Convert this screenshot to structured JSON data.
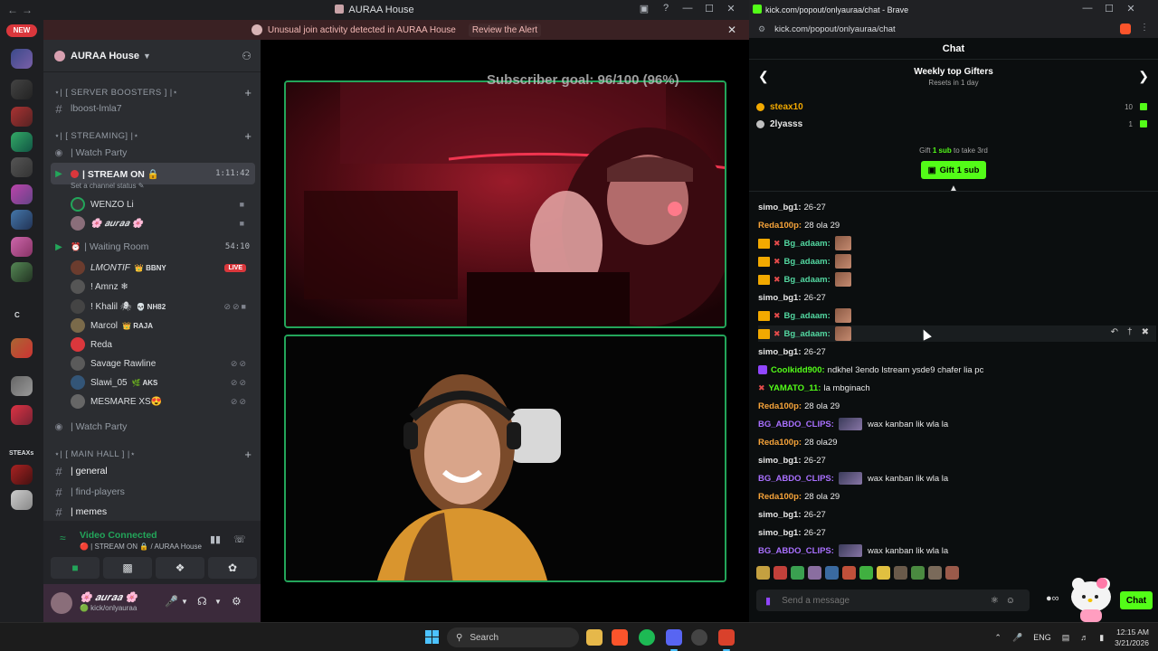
{
  "discord": {
    "window_title": "AURAA House",
    "alert": {
      "text": "Unusual join activity detected in AURAA House",
      "action": "Review the Alert"
    },
    "new_badge": "NEW",
    "server_label": "STEAXs",
    "server_c": "C",
    "server_name": "AURAA House",
    "channels": {
      "cat_boosters": "⋆| [ SERVER BOOSTERS ] |⋆",
      "lboost": "lboost-lmla7",
      "cat_streaming": "⋆| [ STREAMING] |⋆",
      "watch_party_1": "| Watch Party",
      "stream_on": "| STREAM ON 🔒",
      "stream_on_timer": "1:11:42",
      "channel_status": "Set a channel status ✎",
      "waiting_room": "| Waiting Room",
      "waiting_timer": "54:10",
      "watch_party_2": "| Watch Party",
      "cat_main": "⋆| [ MAIN HALL ] |⋆",
      "general": "| general",
      "find_players": "| find-players",
      "memes": "| memes"
    },
    "stream_users": [
      {
        "name": "WENZO Li"
      },
      {
        "name": "🌸 𝒂𝒖𝒓𝒂𝒂 🌸"
      }
    ],
    "waiting_users": [
      {
        "name": "LMONTIF",
        "tag": "👑 BBNY",
        "live": "LIVE"
      },
      {
        "name": "! Amnz ❄",
        "tag": ""
      },
      {
        "name": "!  Khalil 🕷",
        "tag": "💀 NH82"
      },
      {
        "name": "Marcol",
        "tag": "👑 RAJA"
      },
      {
        "name": "Reda",
        "tag": ""
      },
      {
        "name": "Savage Rawline",
        "tag": ""
      },
      {
        "name": "Slawi_05",
        "tag": "🌿 AKS"
      },
      {
        "name": "MESMARE XS😍",
        "tag": ""
      }
    ],
    "voice": {
      "status": "Video Connected",
      "sub": "🔴 | STREAM ON 🔒 / AURAA House"
    },
    "user": {
      "name": "🌸 𝒂𝒖𝒓𝒂𝒂 🌸",
      "sub": "🟢 kick/onlyauraa"
    },
    "subscriber_goal": "Subscriber goal: 96/100 (96%)"
  },
  "browser": {
    "title": "kick.com/popout/onlyauraa/chat - Brave",
    "url": "kick.com/popout/onlyauraa/chat",
    "chat_title": "Chat",
    "gifters_title": "Weekly top Gifters",
    "gifters_sub": "Resets in 1 day",
    "gifters": [
      {
        "name": "steax10",
        "count": "10",
        "color": "#f2a900"
      },
      {
        "name": "2lyasss",
        "count": "1",
        "color": "#c0c0c0"
      }
    ],
    "gift_hint_pre": "Gift",
    "gift_hint_bold": "1 sub",
    "gift_hint_post": "to take 3rd",
    "gift_button": "Gift 1 sub",
    "messages": [
      {
        "user": "simo_bg1:",
        "color": "#e8e8e8",
        "text": "26-27",
        "badge": ""
      },
      {
        "user": "Reda100p:",
        "color": "#f7a43a",
        "text": "28 ola 29",
        "badge": ""
      },
      {
        "user": "Bg_adaam:",
        "color": "#53d8a1",
        "text": "",
        "badge": "crown"
      },
      {
        "user": "Bg_adaam:",
        "color": "#53d8a1",
        "text": "",
        "badge": "crown"
      },
      {
        "user": "Bg_adaam:",
        "color": "#53d8a1",
        "text": "",
        "badge": "crown"
      },
      {
        "user": "simo_bg1:",
        "color": "#e8e8e8",
        "text": "26-27",
        "badge": ""
      },
      {
        "user": "Bg_adaam:",
        "color": "#53d8a1",
        "text": "",
        "badge": "crown"
      },
      {
        "user": "Bg_adaam:",
        "color": "#53d8a1",
        "text": "",
        "badge": "crown"
      },
      {
        "user": "simo_bg1:",
        "color": "#e8e8e8",
        "text": "26-27",
        "badge": ""
      },
      {
        "user": "Coolkidd900:",
        "color": "#53fc18",
        "text": "ndkhel 3endo lstream ysde9 chafer lia pc",
        "badge": "grid"
      },
      {
        "user": "YAMATO_11:",
        "color": "#53fc18",
        "text": "la mbginach",
        "badge": "sub"
      },
      {
        "user": "Reda100p:",
        "color": "#f7a43a",
        "text": "28 ola 29",
        "badge": ""
      },
      {
        "user": "BG_ABDO_CLIPS:",
        "color": "#a970ff",
        "text": "wax kanban lik wla la",
        "badge": ""
      },
      {
        "user": "Reda100p:",
        "color": "#f7a43a",
        "text": "28 ola29",
        "badge": ""
      },
      {
        "user": "simo_bg1:",
        "color": "#e8e8e8",
        "text": "26-27",
        "badge": ""
      },
      {
        "user": "BG_ABDO_CLIPS:",
        "color": "#a970ff",
        "text": "wax kanban lik wla la",
        "badge": ""
      },
      {
        "user": "Reda100p:",
        "color": "#f7a43a",
        "text": "28 ola 29",
        "badge": ""
      },
      {
        "user": "simo_bg1:",
        "color": "#e8e8e8",
        "text": "26-27",
        "badge": ""
      },
      {
        "user": "simo_bg1:",
        "color": "#e8e8e8",
        "text": "26-27",
        "badge": ""
      },
      {
        "user": "BG_ABDO_CLIPS:",
        "color": "#a970ff",
        "text": "wax kanban lik wla la",
        "badge": ""
      }
    ],
    "composer_placeholder": "Send a message",
    "send_label": "Chat"
  },
  "taskbar": {
    "search": "Search",
    "lang": "ENG",
    "time": "12:15 AM",
    "date": "3/21/2026"
  },
  "colors": {
    "kick_green": "#53fc18",
    "discord_green": "#23a55a",
    "discord_red": "#da373c"
  }
}
